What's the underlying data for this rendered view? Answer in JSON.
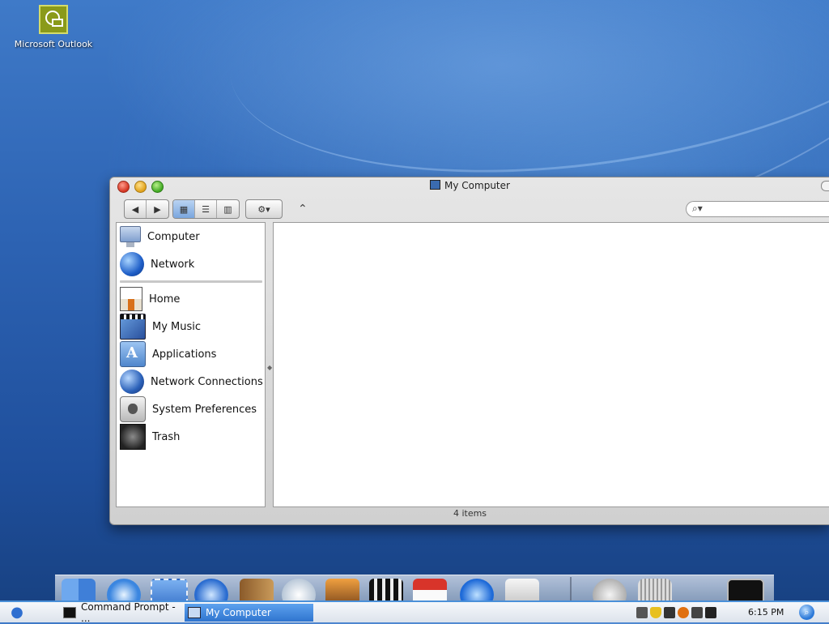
{
  "desktop": {
    "icons": [
      {
        "label": "Microsoft Outlook",
        "icon": "outlook-icon"
      }
    ]
  },
  "window": {
    "title": "My Computer",
    "search": {
      "value": "",
      "placeholder": ""
    },
    "toolbar": {
      "nav": [
        "back-arrow-icon",
        "forward-arrow-icon"
      ],
      "views": [
        "icon-view-icon",
        "list-view-icon",
        "column-view-icon"
      ],
      "active_view": "icon-view-icon",
      "action": "gear-icon",
      "path": "path-chevron-icon"
    },
    "sidebar": {
      "top": [
        {
          "label": "Computer",
          "icon": "computer-icon"
        },
        {
          "label": "Network",
          "icon": "network-globe-icon"
        }
      ],
      "places": [
        {
          "label": "Home",
          "icon": "home-icon"
        },
        {
          "label": "My Music",
          "icon": "music-clapper-icon"
        },
        {
          "label": "Applications",
          "icon": "applications-icon"
        },
        {
          "label": "Network Connections",
          "icon": "network-connections-icon"
        },
        {
          "label": "System Preferences",
          "icon": "system-preferences-icon"
        },
        {
          "label": "Trash",
          "icon": "trash-icon"
        }
      ]
    },
    "status": "4 items"
  },
  "dock": {
    "items": [
      "finder-icon",
      "safari-icon",
      "mail-stamp-icon",
      "ichat-icon",
      "address-book-icon",
      "itunes-icon",
      "iphoto-icon",
      "imovie-icon",
      "ical-icon",
      "quicktime-icon",
      "system-preferences-icon",
      "mail-at-icon",
      "trash-icon",
      "terminal-icon"
    ]
  },
  "taskbar": {
    "tasks": [
      {
        "label": "Command Prompt - ...",
        "icon": "command-prompt-icon"
      },
      {
        "label": "My Computer",
        "icon": "my-computer-icon",
        "active": true
      }
    ],
    "tray": [
      "keyboard-icon",
      "shield-icon",
      "battery-icon",
      "magnifier-icon",
      "volume-icon",
      "display-icon"
    ],
    "clock": "6:15 PM"
  },
  "colors": {
    "taskbar_active": "#2f74cf",
    "desktop_blue": "#2c62b2",
    "close_red": "#d2321f",
    "minimize_yellow": "#e0a018",
    "zoom_green": "#3ea820"
  }
}
